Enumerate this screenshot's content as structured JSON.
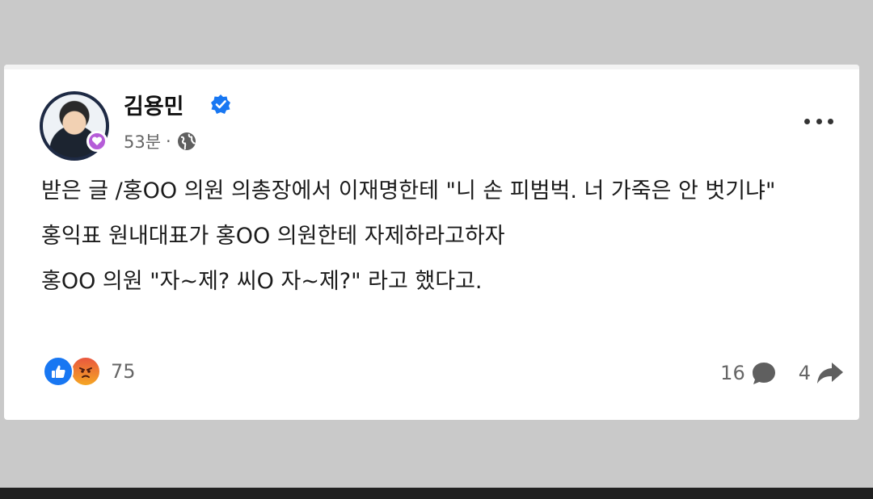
{
  "post": {
    "author": "김용민",
    "time": "53분",
    "separator": "·",
    "text": [
      "받은 글 /홍OO 의원 의총장에서 이재명한테 \"니 손 피범벅. 너 가죽은 안 벗기냐\"",
      "홍익표 원내대표가 홍OO 의원한테 자제하라고하자",
      "홍OO 의원 \"자~제? 씨O 자~제?\" 라고 했다고."
    ],
    "reactions_count": "75",
    "comments_count": "16",
    "shares_count": "4",
    "icons": {
      "verified": "verified-badge-icon",
      "privacy": "globe-icon",
      "more": "more-options-icon",
      "like": "like-reaction-icon",
      "angry": "angry-reaction-icon",
      "comment": "comment-icon",
      "share": "share-icon"
    }
  },
  "colors": {
    "like_blue": "#1877f2",
    "verified_blue": "#1877f2",
    "avatar_badge": "#b55cd8"
  }
}
